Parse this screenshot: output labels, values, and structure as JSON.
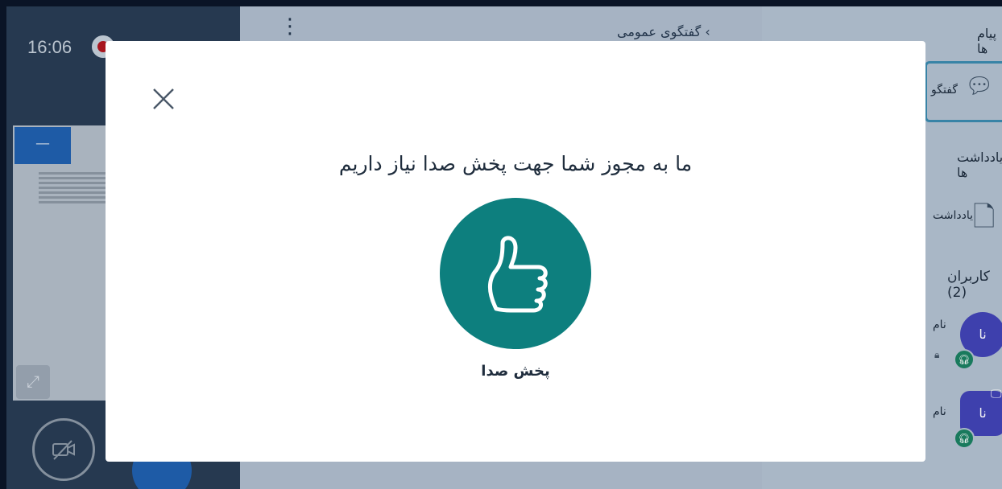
{
  "background": {
    "clock": "16:06",
    "chat_title": "گفتگوی عمومی",
    "panel_title": "پیام ها",
    "chat_tab_label": "گفتگو",
    "notes_heading": "یادداشت ها",
    "notes_item_label": "یادداشت",
    "users_heading": "کاربران (2)",
    "users": [
      {
        "avatar_text": "نا",
        "name": "نام"
      },
      {
        "avatar_text": "نا",
        "name": "نام"
      }
    ]
  },
  "modal": {
    "heading": "ما به مجوز شما جهت پخش صدا نیاز داریم",
    "listen_label": "پخش صدا",
    "accent_color": "#0d7f7e",
    "icons": {
      "close": "close-icon",
      "listen": "thumbs-up-icon"
    }
  }
}
